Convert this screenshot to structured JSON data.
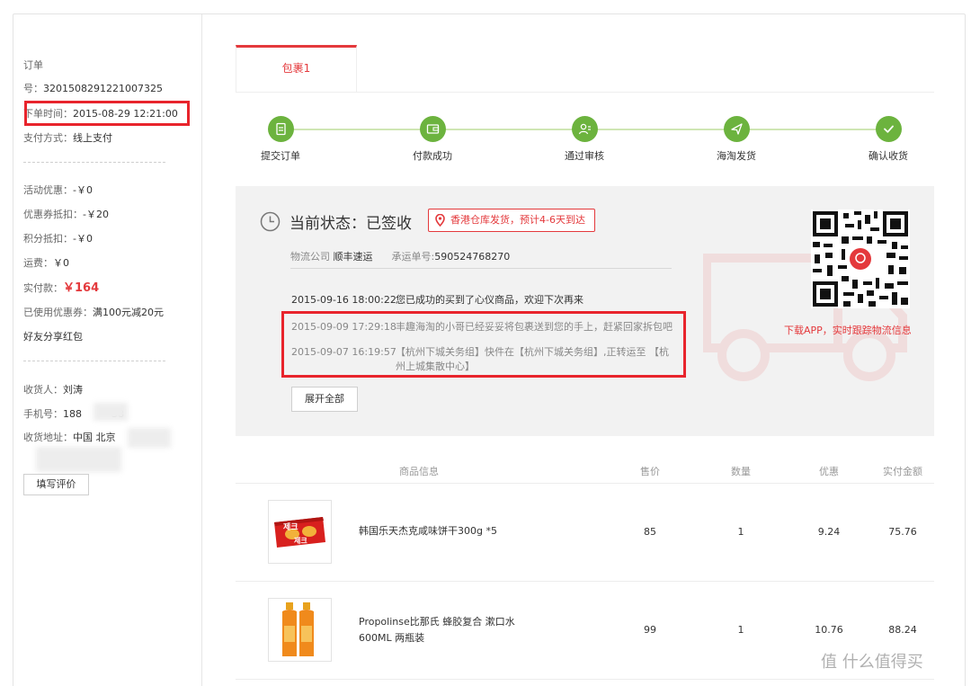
{
  "order": {
    "label": "订单",
    "number_label": "号：",
    "number": "3201508291221007325",
    "time_label": "下单时间：",
    "time": "2015-08-29 12:21:00",
    "pay_label": "支付方式：",
    "pay": "线上支付",
    "promo_label": "活动优惠：",
    "promo": "-￥0",
    "coupon_label": "优惠券抵扣：",
    "coupon": "-￥20",
    "points_label": "积分抵扣：",
    "points": "-￥0",
    "shipping_label": "运费：",
    "shipping": "￥0",
    "paid_label": "实付款：",
    "paid": "￥164",
    "used_coupon_label": "已使用优惠券：",
    "used_coupon": "满100元减20元",
    "share_label": "好友分享红包",
    "receiver_label": "收货人：",
    "receiver": "刘涛",
    "phone_label": "手机号：",
    "phone_prefix": "188",
    "phone_suffix": "38",
    "address_label": "收货地址：",
    "address": "中国 北京",
    "review_button": "填写评价"
  },
  "tabs": [
    "包裹1"
  ],
  "progress": {
    "steps": [
      "提交订单",
      "付款成功",
      "通过审核",
      "海淘发货",
      "确认收货"
    ]
  },
  "status": {
    "title": "当前状态：已签收",
    "ship_note": "香港仓库发货，预计4-6天到达",
    "carrier_label": "物流公司",
    "carrier": "顺丰速运",
    "tracking_label": "承运单号:",
    "tracking": "590524768270",
    "events": [
      {
        "time": "2015-09-16 18:00:22",
        "msg": "您已成功的买到了心仪商品，欢迎下次再来"
      },
      {
        "time": "2015-09-09 17:29:18",
        "msg": "丰趣海淘的小哥已经妥妥将包裹送到您的手上，赶紧回家拆包吧"
      },
      {
        "time": "2015-09-07 16:19:57",
        "msg_line1": "【杭州下城关务组】快件在【杭州下城关务组】,正转运至 【杭",
        "msg_line2": "州上城集散中心】"
      }
    ],
    "expand_button": "展开全部",
    "app_caption": "下载APP，实时跟踪物流信息"
  },
  "table": {
    "headers": [
      "商品信息",
      "售价",
      "数量",
      "优惠",
      "实付金额"
    ],
    "rows": [
      {
        "name": "韩国乐天杰克咸味饼干300g *5",
        "price": "85",
        "qty": "1",
        "discount": "9.24",
        "paid": "75.76",
        "thumb_text": "제크"
      },
      {
        "name_line1": "Propolinse比那氏 蜂胶复合 漱口水",
        "name_line2": "600ML 两瓶装",
        "price": "99",
        "qty": "1",
        "discount": "10.76",
        "paid": "88.24"
      }
    ]
  },
  "watermark": "值 什么值得买",
  "colors": {
    "accent": "#e4393c",
    "success": "#6cb33e",
    "highlight_box": "#e8242c"
  }
}
